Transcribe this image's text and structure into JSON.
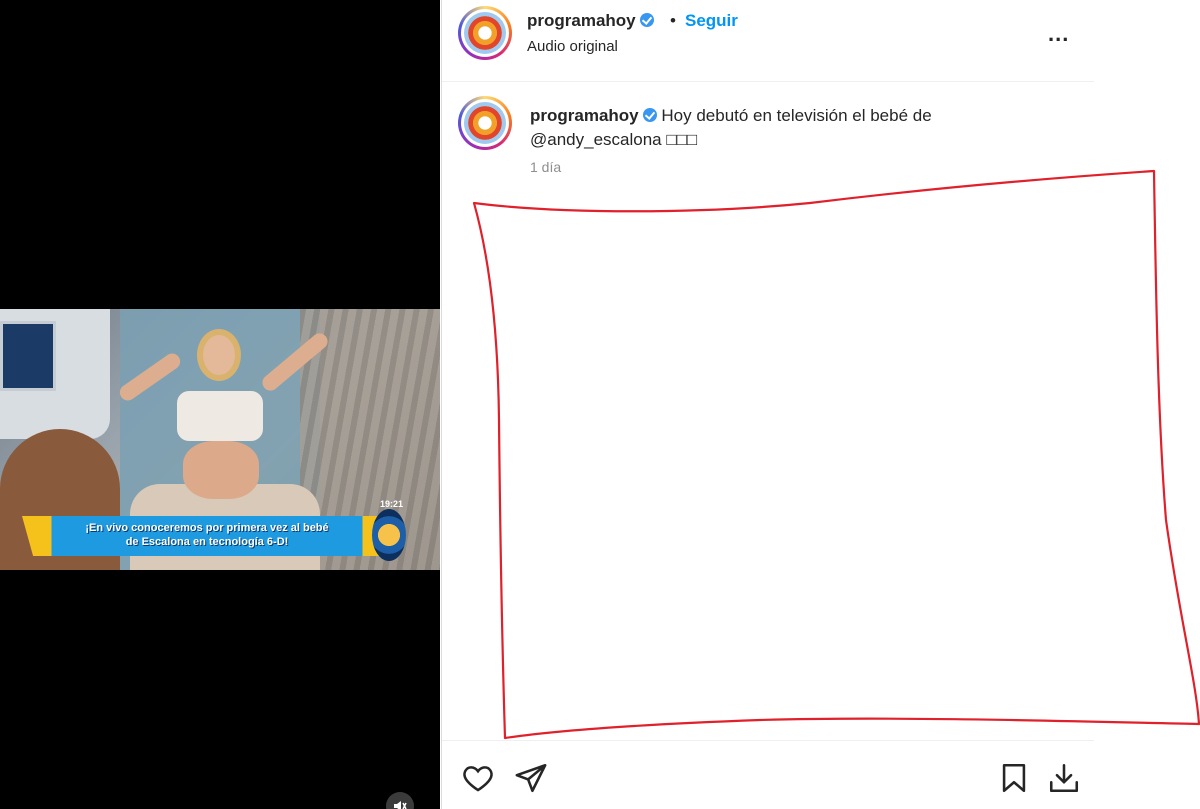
{
  "media": {
    "ticker_line1": "¡En vivo conoceremos por primera vez al bebé",
    "ticker_line2": "de Escalona en tecnología 6-D!",
    "clock": "19:21"
  },
  "header": {
    "username": "programahoy",
    "separator": "•",
    "follow_label": "Seguir",
    "audio_label": "Audio original",
    "more_label": "..."
  },
  "caption": {
    "username": "programahoy",
    "text": "Hoy debutó en televisión el bebé de",
    "mention": "@andy_escalona",
    "emoji": "□□□",
    "time": "1 día"
  },
  "colors": {
    "accent": "#0095f6",
    "verified": "#3897f0",
    "annotation": "#e0202a"
  },
  "icons": [
    "verified-icon",
    "more-options-icon",
    "heart-icon",
    "paper-plane-icon",
    "bookmark-icon",
    "download-icon",
    "mute-icon"
  ]
}
